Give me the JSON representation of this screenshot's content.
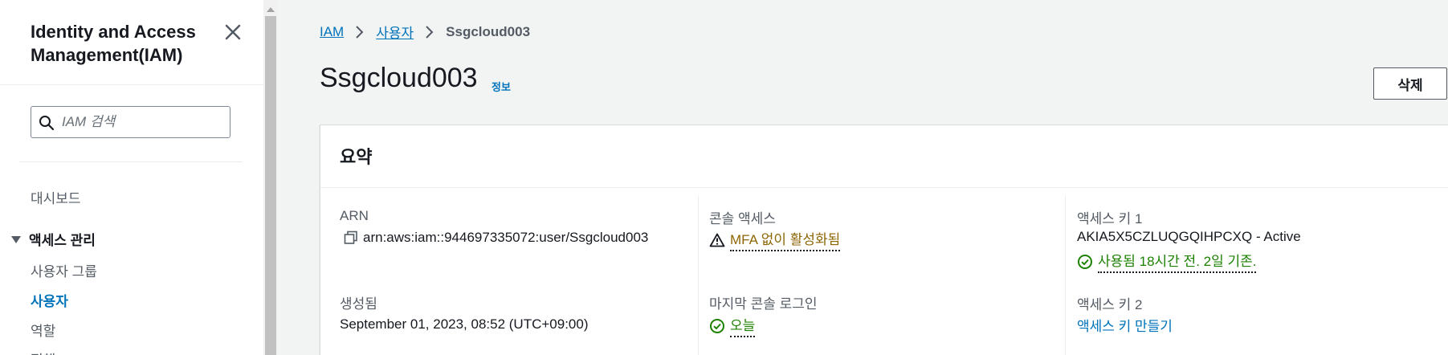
{
  "sidebar": {
    "title": "Identity and Access Management(IAM)",
    "search_placeholder": "IAM 검색",
    "items": {
      "dashboard": "대시보드",
      "access_management": "액세스 관리",
      "user_groups": "사용자 그룹",
      "users": "사용자",
      "roles": "역할",
      "policies": "정책"
    }
  },
  "breadcrumb": {
    "iam": "IAM",
    "users": "사용자",
    "current": "Ssgcloud003"
  },
  "page": {
    "title": "Ssgcloud003",
    "info": "정보",
    "delete_label": "삭제"
  },
  "summary": {
    "title": "요약",
    "arn_label": "ARN",
    "arn_value": "arn:aws:iam::944697335072:user/Ssgcloud003",
    "created_label": "생성됨",
    "created_value": "September 01, 2023, 08:52 (UTC+09:00)",
    "console_access_label": "콘솔 액세스",
    "console_access_value": "MFA 없이 활성화됨",
    "last_login_label": "마지막 콘솔 로그인",
    "last_login_value": "오늘",
    "access_key1_label": "액세스 키 1",
    "access_key1_value": "AKIA5X5CZLUQGQIHPCXQ - Active",
    "access_key1_usage": "사용됨 18시간 전. 2일 기존.",
    "access_key2_label": "액세스 키 2",
    "access_key2_link": "액세스 키 만들기"
  },
  "colors": {
    "link": "#0073bb",
    "warning": "#8d6605",
    "success": "#1d8102"
  }
}
